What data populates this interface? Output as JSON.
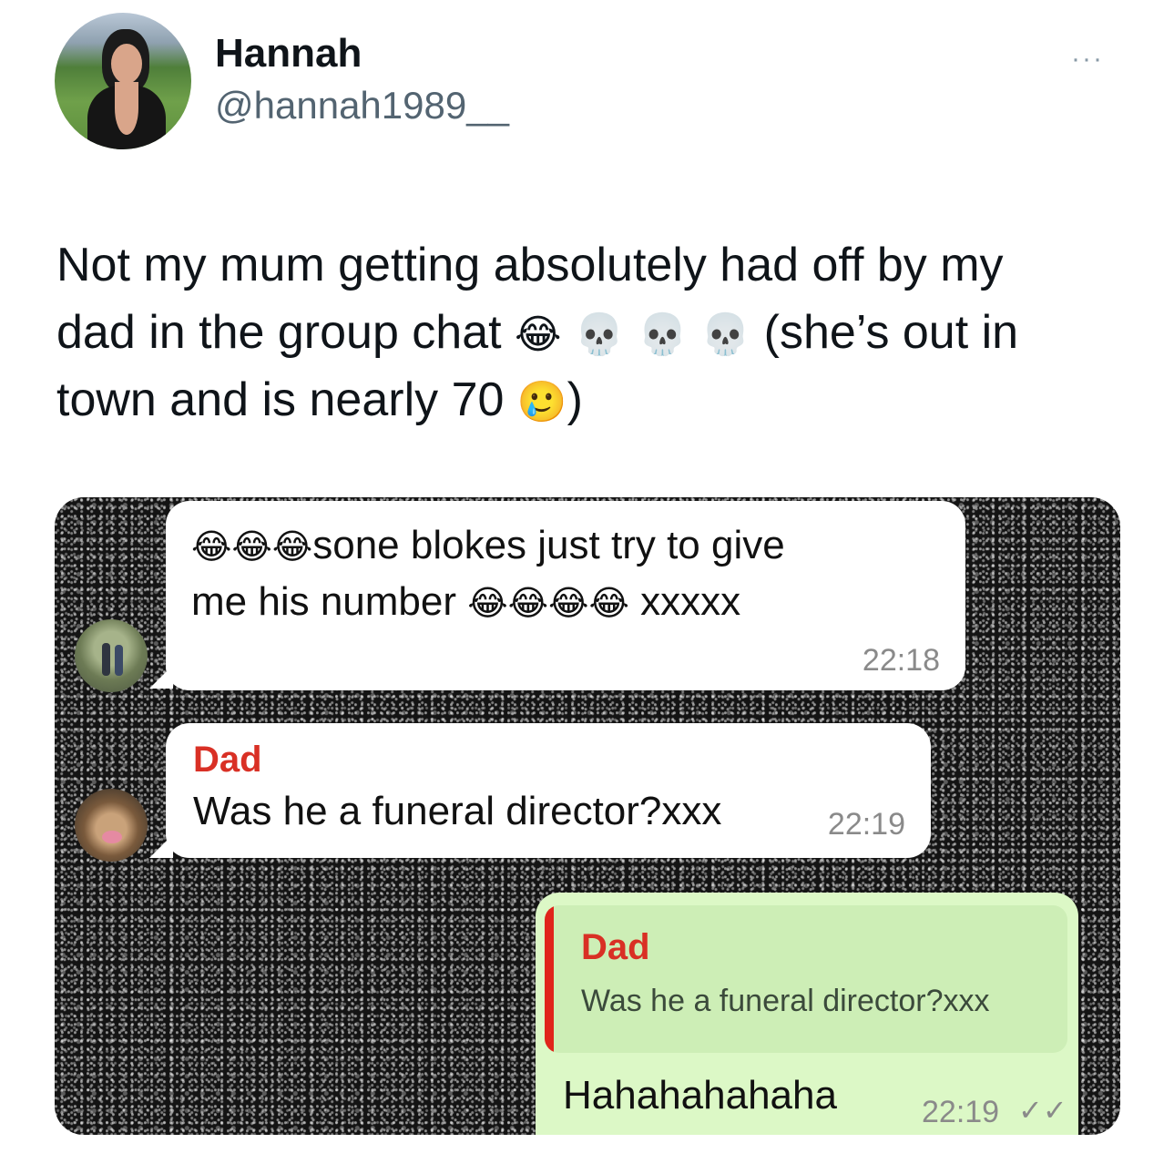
{
  "tweet": {
    "author_name": "Hannah",
    "author_handle": "@hannah1989__",
    "more_icon": "···",
    "line1": "Not my mum getting absolutely had off by my",
    "line2_a": "dad in the group chat",
    "line2_b": "(she’s out in",
    "line3_a": "town and is nearly 70",
    "line3_b": ")",
    "emoji_laugh": "😂",
    "emoji_skull": "💀",
    "emoji_sad": "🥲"
  },
  "chat": {
    "message1": {
      "emoji_lead": "😂😂😂",
      "line1_text": "sone blokes just try to give",
      "line2_text": "me his number",
      "emoji_trail": "😂😂😂😂",
      "suffix": "xxxxx",
      "time": "22:18"
    },
    "message2": {
      "sender": "Dad",
      "text": "Was he a funeral director?xxx",
      "time": "22:19"
    },
    "message3": {
      "quoted_sender": "Dad",
      "quoted_text": "Was he a funeral director?xxx",
      "text": "Hahahahahaha",
      "time": "22:19",
      "ticks": "✓✓"
    }
  }
}
